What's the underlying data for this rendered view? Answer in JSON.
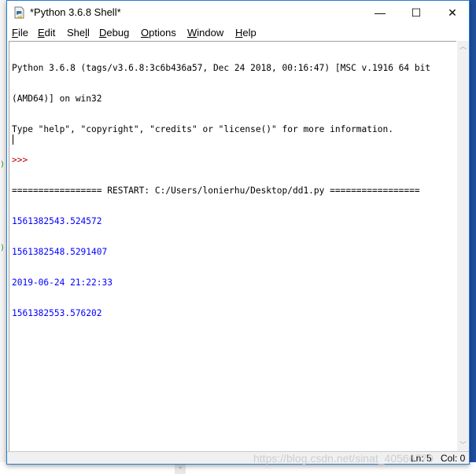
{
  "window": {
    "title": "*Python 3.6.8 Shell*",
    "controls": {
      "minimize": "—",
      "maximize": "☐",
      "close": "✕"
    }
  },
  "menu": {
    "items": [
      {
        "label": "File",
        "mnemonic": "F",
        "rest": "ile"
      },
      {
        "label": "Edit",
        "mnemonic": "E",
        "rest": "dit"
      },
      {
        "label": "Shell",
        "pre": "She",
        "mnemonic": "l",
        "rest": "l"
      },
      {
        "label": "Debug",
        "mnemonic": "D",
        "rest": "ebug"
      },
      {
        "label": "Options",
        "mnemonic": "O",
        "rest": "ptions"
      },
      {
        "label": "Window",
        "mnemonic": "W",
        "rest": "indow"
      },
      {
        "label": "Help",
        "mnemonic": "H",
        "rest": "elp"
      }
    ]
  },
  "shell": {
    "lines": [
      {
        "text": "Python 3.6.8 (tags/v3.6.8:3c6b436a57, Dec 24 2018, 00:16:47) [MSC v.1916 64 bit",
        "kind": "stdout-black"
      },
      {
        "text": "(AMD64)] on win32",
        "kind": "stdout-black"
      },
      {
        "text": "Type \"help\", \"copyright\", \"credits\" or \"license()\" for more information.",
        "kind": "stdout-black"
      },
      {
        "text": ">>> ",
        "kind": "prompt"
      },
      {
        "text": "================= RESTART: C:/Users/lonierhu/Desktop/dd1.py =================",
        "kind": "stdout-black"
      },
      {
        "text": "1561382543.524572",
        "kind": "output"
      },
      {
        "text": "1561382548.5291407",
        "kind": "output"
      },
      {
        "text": "2019-06-24 21:22:33",
        "kind": "output"
      },
      {
        "text": "1561382553.576202",
        "kind": "output"
      }
    ]
  },
  "status": {
    "line": "Ln: 5",
    "col": "Col: 0"
  },
  "watermark": "https://blog.csdn.net/sinat_40566770",
  "colors": {
    "output": "#0000ff",
    "prompt": "#c00000",
    "window_border": "#2b7bd4",
    "desktop": "#1e4fa0"
  }
}
